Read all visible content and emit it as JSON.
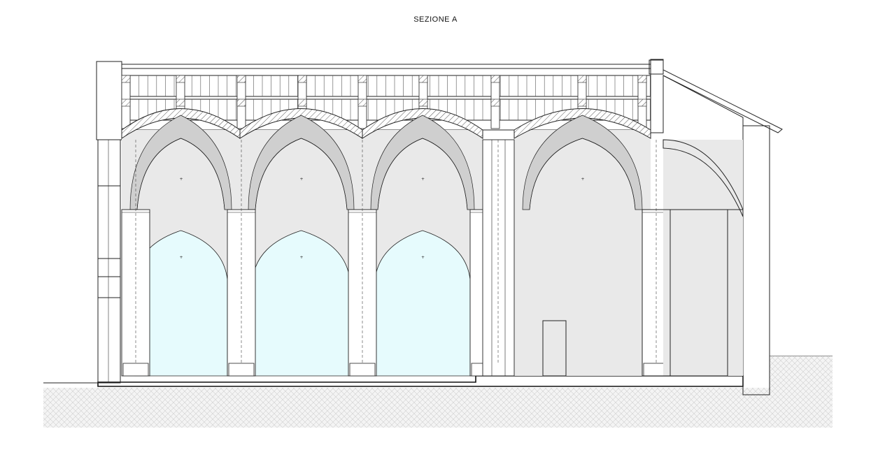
{
  "drawing": {
    "title": "SEZIONE A",
    "colors": {
      "background": "#ffffff",
      "vault_interior": "#e9e9e9",
      "vault_rib": "#cfcfcf",
      "glazed_arch": "#e6fbfd",
      "glazed_wall": "#dff8fa",
      "masonry_hatch": "#555555",
      "ground": "#d6d6d6",
      "line": "#222222"
    },
    "bays": 4
  }
}
